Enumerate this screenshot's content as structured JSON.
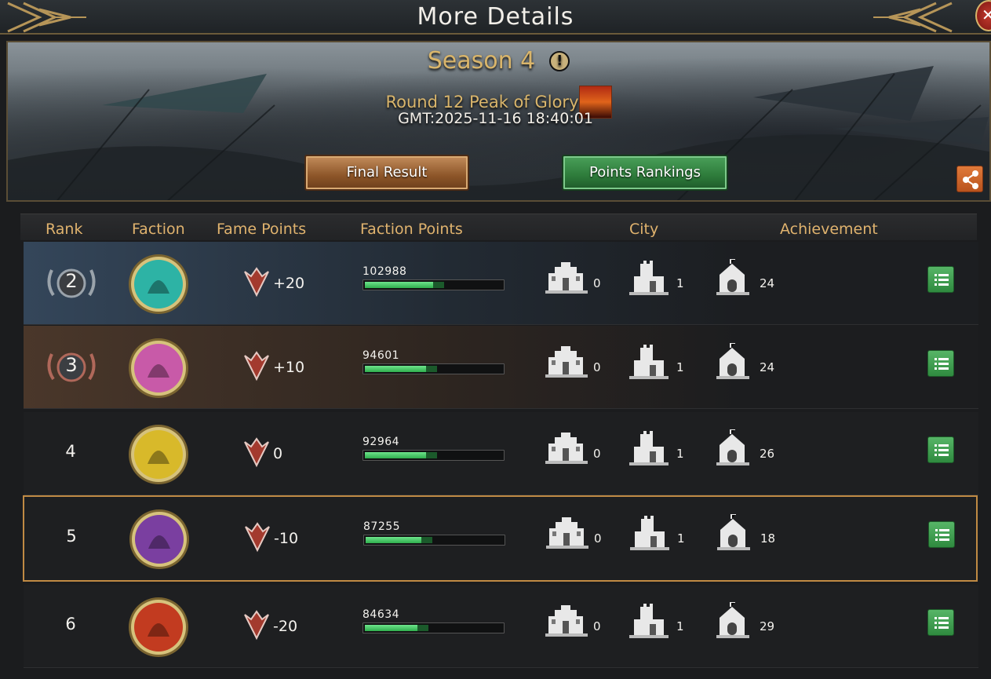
{
  "window": {
    "title": "More Details"
  },
  "banner": {
    "season": "Season 4",
    "round": "Round 12 Peak of Glory",
    "gmt": "GMT:2025-11-16 18:40:01",
    "final_result_label": "Final Result",
    "points_rankings_label": "Points Rankings"
  },
  "table": {
    "headers": {
      "rank": "Rank",
      "faction": "Faction",
      "fame_points": "Fame Points",
      "faction_points": "Faction Points",
      "city": "City",
      "achievement": "Achievement"
    },
    "rows": [
      {
        "rank": "2",
        "faction_icon": "kraken-sigil-icon",
        "faction_color": "#2db3a5",
        "fame": "+20",
        "faction_points": "102988",
        "points_fraction": 0.57,
        "city_a": "0",
        "city_b": "1",
        "city_c": "24"
      },
      {
        "rank": "3",
        "faction_icon": "stag-sigil-icon",
        "faction_color": "#c85aa8",
        "fame": "+10",
        "faction_points": "94601",
        "points_fraction": 0.52,
        "city_a": "0",
        "city_b": "1",
        "city_c": "24"
      },
      {
        "rank": "4",
        "faction_icon": "direwolf-sigil-icon",
        "faction_color": "#d8b92a",
        "fame": "0",
        "faction_points": "92964",
        "points_fraction": 0.52,
        "city_a": "0",
        "city_b": "1",
        "city_c": "26"
      },
      {
        "rank": "5",
        "faction_icon": "dragon-sigil-icon",
        "faction_color": "#7a3fa0",
        "fame": "-10",
        "faction_points": "87255",
        "points_fraction": 0.48,
        "city_a": "0",
        "city_b": "1",
        "city_c": "18"
      },
      {
        "rank": "6",
        "faction_icon": "lion-sigil-icon",
        "faction_color": "#c23b20",
        "fame": "-20",
        "faction_points": "84634",
        "points_fraction": 0.46,
        "city_a": "0",
        "city_b": "1",
        "city_c": "29"
      }
    ]
  },
  "colors": {
    "gold_text": "#d9b56b",
    "header_text": "#e0b36e",
    "progress_green": "#3fcf63",
    "button_green": "#3a9a4b",
    "button_brown": "#9a6232"
  }
}
